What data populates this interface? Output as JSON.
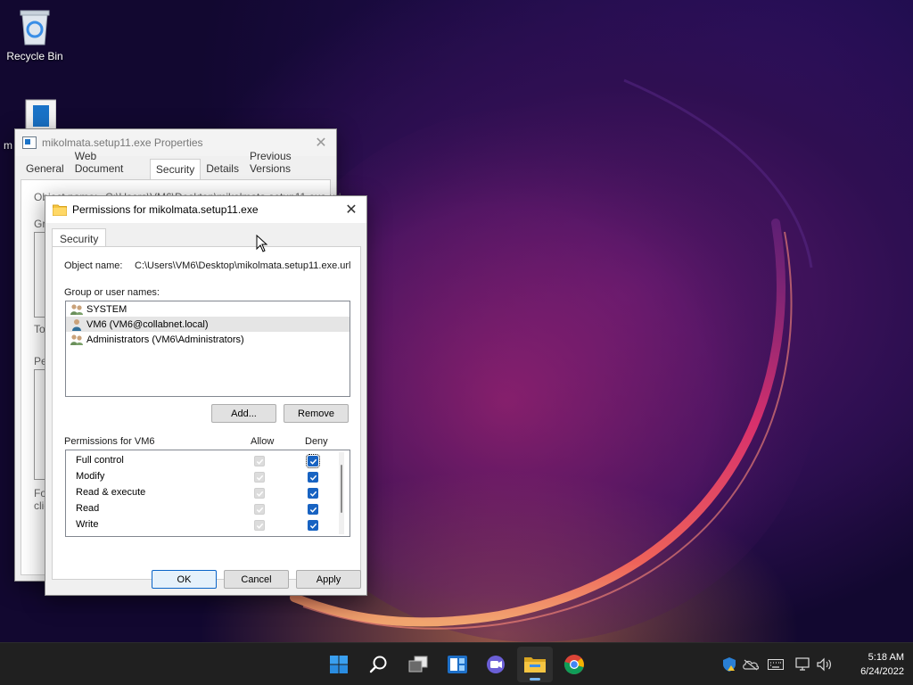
{
  "desktop": {
    "recycle_bin_label": "Recycle Bin",
    "file_icon_label_fragment": "m"
  },
  "properties_window": {
    "title": "mikolmata.setup11.exe Properties",
    "tabs": [
      "General",
      "Web Document",
      "Security",
      "Details",
      "Previous Versions"
    ],
    "active_tab": "Security",
    "object_name_fragment": "Object name:",
    "object_path_fragment": "C:\\Users\\VM6\\Desktop\\mikolmata.setup11.exe.url",
    "group_fragment": "Gro",
    "to_fragment": "To",
    "pe_fragment": "Pe",
    "fo_fragment": "Fo",
    "clic_fragment": "clic"
  },
  "permissions_dialog": {
    "title": "Permissions for mikolmata.setup11.exe",
    "tab": "Security",
    "object_name_label": "Object name:",
    "object_name_value": "C:\\Users\\VM6\\Desktop\\mikolmata.setup11.exe.url",
    "group_label": "Group or user names:",
    "users": [
      {
        "name": "SYSTEM",
        "icon": "group-users-icon",
        "selected": false
      },
      {
        "name": "VM6 (VM6@collabnet.local)",
        "icon": "single-user-icon",
        "selected": true
      },
      {
        "name": "Administrators (VM6\\Administrators)",
        "icon": "group-users-icon",
        "selected": false
      }
    ],
    "add_button": "Add...",
    "remove_button": "Remove",
    "permissions_for_label": "Permissions for VM6",
    "allow_header": "Allow",
    "deny_header": "Deny",
    "permissions": [
      {
        "name": "Full control",
        "allow": true,
        "allow_disabled": true,
        "deny": true
      },
      {
        "name": "Modify",
        "allow": true,
        "allow_disabled": true,
        "deny": true
      },
      {
        "name": "Read & execute",
        "allow": true,
        "allow_disabled": true,
        "deny": true
      },
      {
        "name": "Read",
        "allow": true,
        "allow_disabled": true,
        "deny": true
      },
      {
        "name": "Write",
        "allow": true,
        "allow_disabled": true,
        "deny": true
      }
    ],
    "ok_button": "OK",
    "cancel_button": "Cancel",
    "apply_button": "Apply"
  },
  "taskbar": {
    "apps": [
      "start-icon",
      "search-icon",
      "task-view-icon",
      "widgets-icon",
      "teams-chat-icon",
      "file-explorer-icon",
      "chrome-icon"
    ],
    "active_app": "file-explorer-icon",
    "tray": [
      "defender-icon",
      "onedrive-icon",
      "keyboard-icon",
      "network-icon",
      "volume-icon"
    ],
    "time": "5:18 AM",
    "date": "6/24/2022"
  },
  "colors": {
    "accent": "#1863c2",
    "taskbar": "#202020",
    "folder": "#f5c542"
  }
}
